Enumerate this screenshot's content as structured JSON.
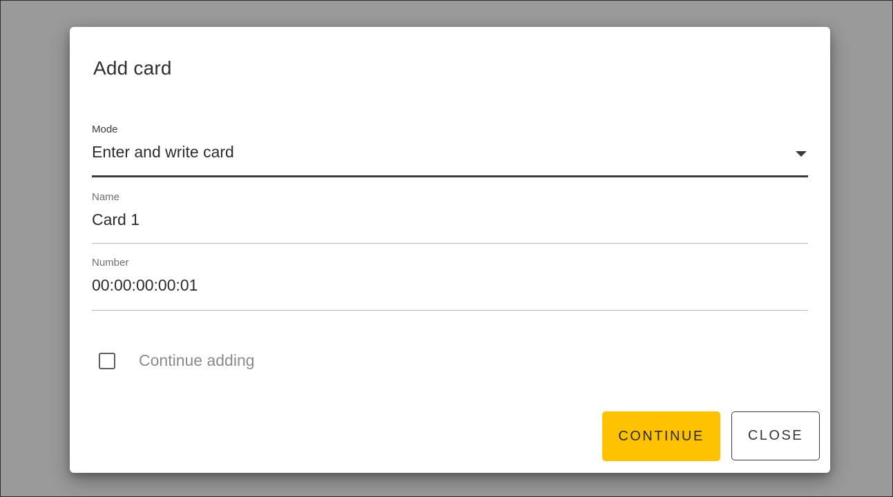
{
  "dialog": {
    "title": "Add card",
    "fields": {
      "mode": {
        "label": "Mode",
        "value": "Enter and write card"
      },
      "name": {
        "label": "Name",
        "value": "Card 1"
      },
      "number": {
        "label": "Number",
        "value": "00:00:00:00:01"
      }
    },
    "continue_adding": {
      "label": "Continue adding",
      "checked": false
    },
    "buttons": {
      "continue": "CONTINUE",
      "close": "CLOSE"
    }
  },
  "colors": {
    "accent": "#ffc200",
    "overlay": "#9a9a9a"
  }
}
